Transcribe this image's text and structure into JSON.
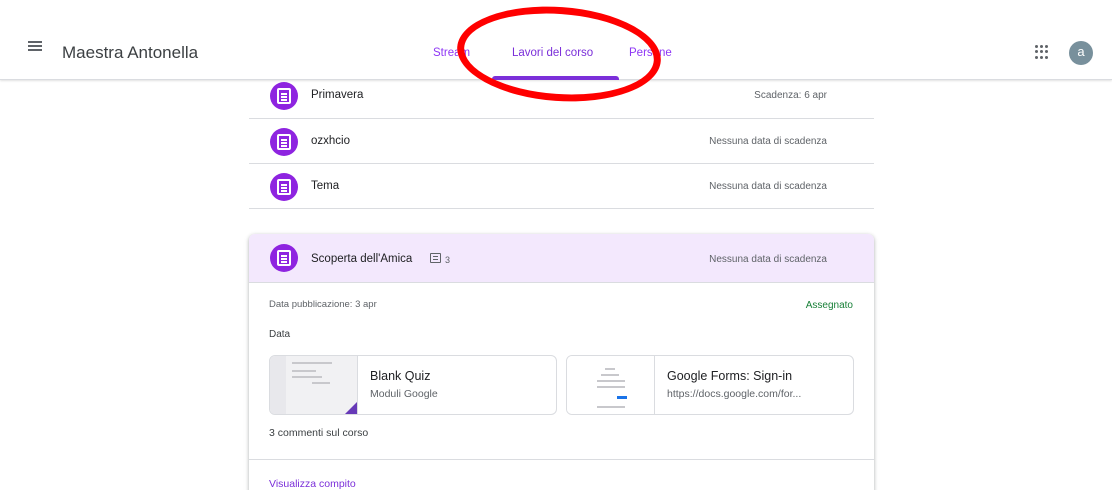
{
  "header": {
    "course_title": "Maestra Antonella",
    "tabs": [
      {
        "label": "Stream"
      },
      {
        "label": "Lavori del corso",
        "active": true
      },
      {
        "label": "Persone"
      }
    ],
    "avatar_letter": "a",
    "accent_color": "#7b2fd9"
  },
  "icons": {
    "menu": "hamburger-menu-icon",
    "apps": "google-apps-grid-icon",
    "assignment": "assignment-doc-icon",
    "comment": "comment-icon"
  },
  "assignments": [
    {
      "title": "Primavera",
      "due": "Scadenza: 6 apr"
    },
    {
      "title": "ozxhcio",
      "due": "Nessuna data di scadenza"
    },
    {
      "title": "Tema",
      "due": "Nessuna data di scadenza"
    }
  ],
  "expanded": {
    "title": "Scoperta dell'Amica",
    "comment_count": "3",
    "due": "Nessuna data di scadenza",
    "published": "Data pubblicazione: 3 apr",
    "status": "Assegnato",
    "description": "Data",
    "attachments": [
      {
        "title": "Blank Quiz",
        "subtitle": "Moduli Google"
      },
      {
        "title": "Google Forms: Sign-in",
        "subtitle": "https://docs.google.com/for..."
      }
    ],
    "class_comments": "3 commenti sul corso",
    "view_link": "Visualizza compito"
  }
}
